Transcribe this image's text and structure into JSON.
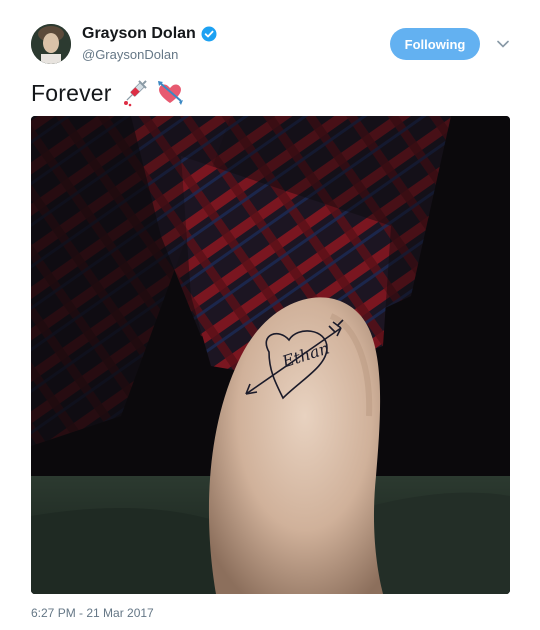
{
  "user": {
    "display_name": "Grayson Dolan",
    "handle": "@GraysonDolan",
    "verified": true
  },
  "follow_button": {
    "label": "Following"
  },
  "tweet": {
    "text": "Forever",
    "emojis": [
      "syringe-icon",
      "heart-with-arrow-icon"
    ],
    "media": {
      "tattoo_text": "Ethan"
    },
    "timestamp": "6:27 PM - 21 Mar 2017"
  },
  "colors": {
    "accent": "#63b1f1",
    "verified": "#1da1f2",
    "secondary_text": "#657786"
  }
}
